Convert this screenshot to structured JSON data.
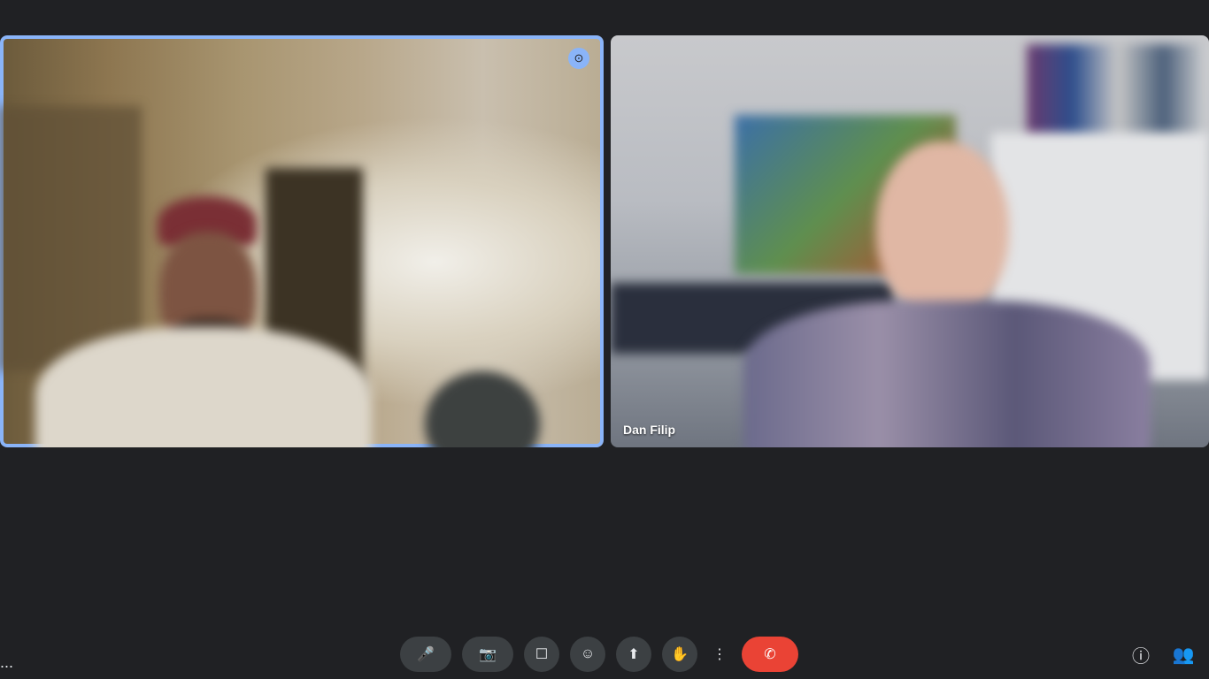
{
  "participants": [
    {
      "name": "",
      "active_speaker": true
    },
    {
      "name": "Dan Filip"
    }
  ],
  "footer": {
    "meeting_name": "...",
    "end_call_label": ""
  },
  "icons": {
    "pin": "⊙",
    "mic": "🎤",
    "camera": "📷",
    "captions": "☐",
    "raise_hand": "✋",
    "present": "⬆",
    "reactions": "☺",
    "more": "⋮",
    "end_call": "✆",
    "info": "ⓘ",
    "people": "👥"
  },
  "colors": {
    "background": "#202124",
    "active_outline": "#8ab4f8",
    "end_call": "#ea4335"
  }
}
